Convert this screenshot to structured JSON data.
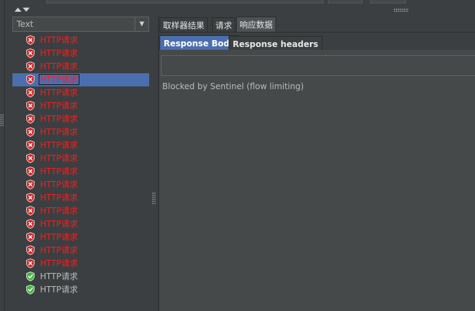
{
  "tree": {
    "view_selector": {
      "value": "Text"
    },
    "items": [
      {
        "label": "HTTP请求",
        "status": "error"
      },
      {
        "label": "HTTP请求",
        "status": "error"
      },
      {
        "label": "HTTP请求",
        "status": "error"
      },
      {
        "label": "HTTP请求",
        "status": "error",
        "selected": true
      },
      {
        "label": "HTTP请求",
        "status": "error"
      },
      {
        "label": "HTTP请求",
        "status": "error"
      },
      {
        "label": "HTTP请求",
        "status": "error"
      },
      {
        "label": "HTTP请求",
        "status": "error"
      },
      {
        "label": "HTTP请求",
        "status": "error"
      },
      {
        "label": "HTTP请求",
        "status": "error"
      },
      {
        "label": "HTTP请求",
        "status": "error"
      },
      {
        "label": "HTTP请求",
        "status": "error"
      },
      {
        "label": "HTTP请求",
        "status": "error"
      },
      {
        "label": "HTTP请求",
        "status": "error"
      },
      {
        "label": "HTTP请求",
        "status": "error"
      },
      {
        "label": "HTTP请求",
        "status": "error"
      },
      {
        "label": "HTTP请求",
        "status": "error"
      },
      {
        "label": "HTTP请求",
        "status": "error"
      },
      {
        "label": "HTTP请求",
        "status": "ok"
      },
      {
        "label": "HTTP请求",
        "status": "ok"
      }
    ]
  },
  "tabs": [
    {
      "label": "取样器结果",
      "active": false
    },
    {
      "label": "请求",
      "active": false
    },
    {
      "label": "响应数据",
      "active": true
    }
  ],
  "subtabs": [
    {
      "label": "Response Body",
      "active": true
    },
    {
      "label": "Response headers",
      "active": false
    }
  ],
  "response": {
    "body_text": "Blocked by Sentinel (flow limiting)"
  },
  "icons": {
    "error": "shield-x-icon",
    "ok": "shield-check-icon",
    "dropdown": "chevron-down-icon",
    "collapse": "collapse-arrows-icon"
  },
  "colors": {
    "error_text": "#ff1a1a",
    "error_icon": "#d62424",
    "ok_icon": "#3cb93c",
    "selection": "#4b6eaf",
    "background": "#3c3f41"
  }
}
